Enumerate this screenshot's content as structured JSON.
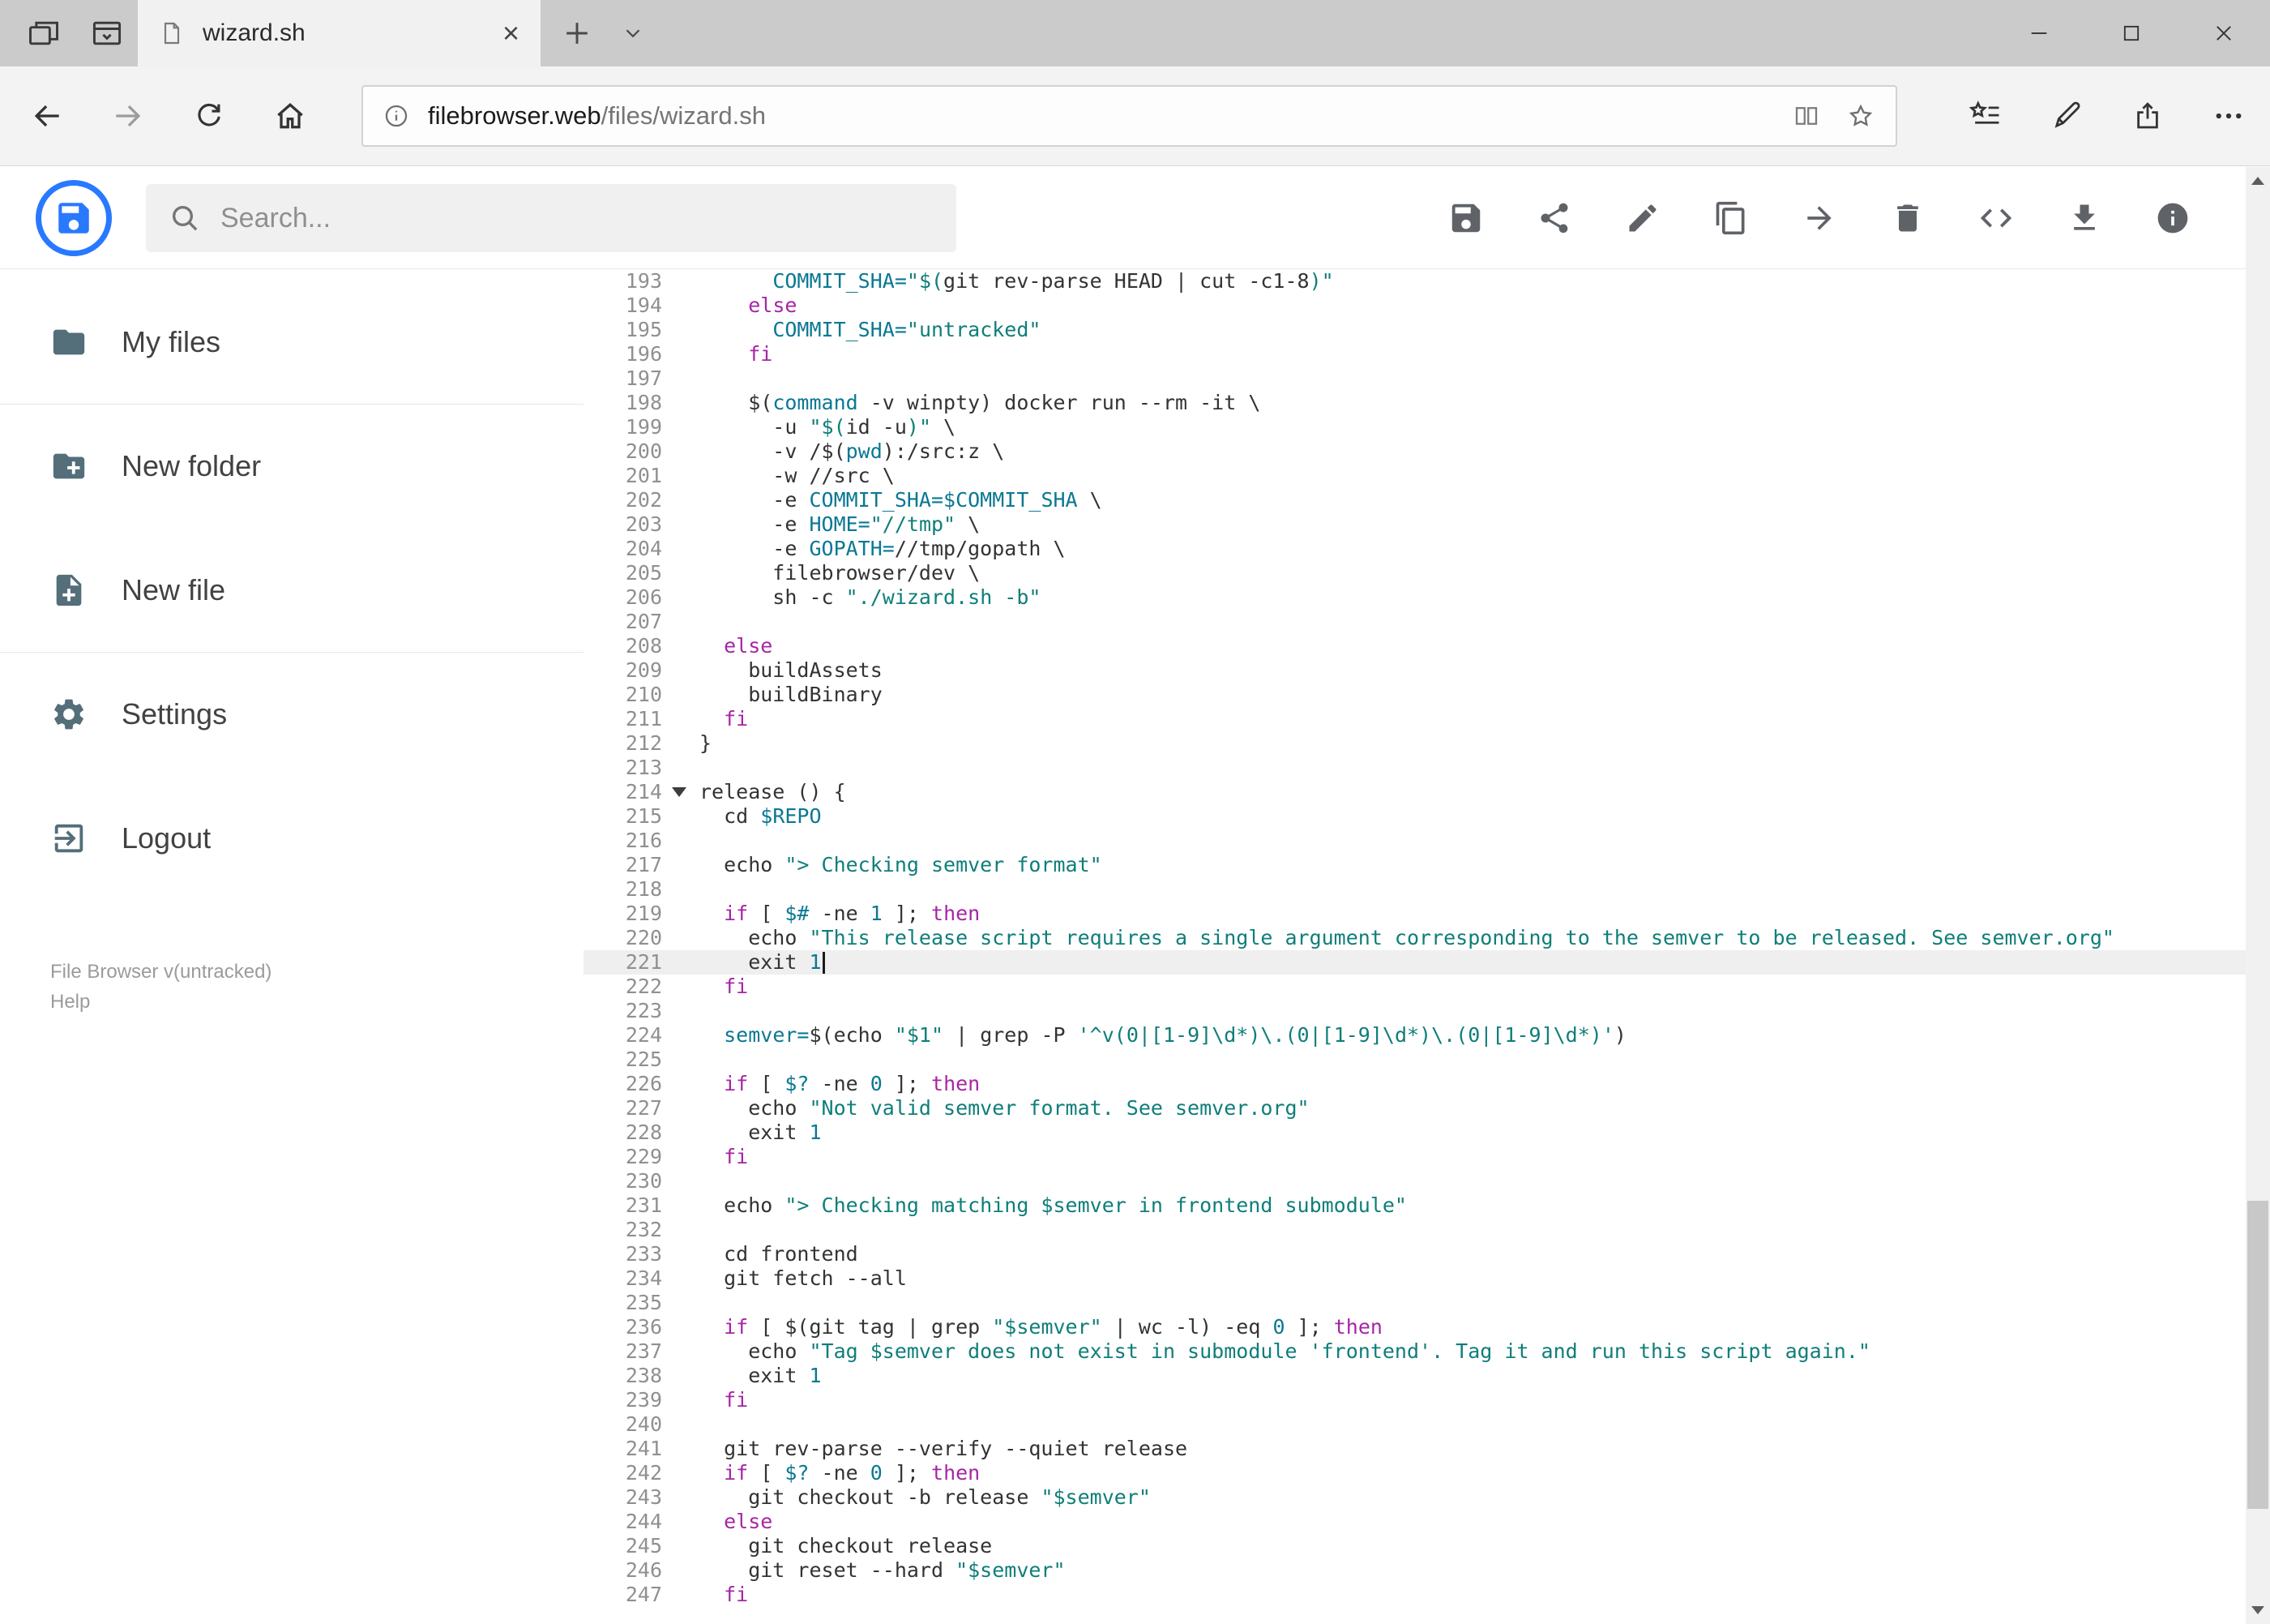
{
  "colors": {
    "accent_blue": "#2979ff",
    "keyword": "#a626a4",
    "string": "#0f7e79",
    "variable": "#0b7893",
    "code_text": "#333333",
    "line_number_gray": "#909090",
    "active_line_bg": "#efefef"
  },
  "browser": {
    "tab_title": "wizard.sh",
    "url_domain": "filebrowser.web",
    "url_path": "/files/wizard.sh"
  },
  "header": {
    "search_placeholder": "Search..."
  },
  "sidebar": {
    "items": [
      {
        "label": "My files",
        "icon": "folder-icon"
      },
      {
        "label": "New folder",
        "icon": "new-folder-icon"
      },
      {
        "label": "New file",
        "icon": "new-file-icon"
      },
      {
        "label": "Settings",
        "icon": "settings-gear-icon"
      },
      {
        "label": "Logout",
        "icon": "logout-icon"
      }
    ],
    "footer_version": "File Browser v(untracked)",
    "footer_help": "Help"
  },
  "editor": {
    "active_line": 221,
    "lines": [
      {
        "n": 193,
        "t": [
          [
            "d",
            "      "
          ],
          [
            "v",
            "COMMIT_SHA="
          ],
          [
            "s",
            "\"$("
          ],
          [
            "d",
            "git rev-parse HEAD | cut -c1-8"
          ],
          [
            "s",
            ")\""
          ]
        ]
      },
      {
        "n": 194,
        "t": [
          [
            "d",
            "    "
          ],
          [
            "k",
            "else"
          ]
        ]
      },
      {
        "n": 195,
        "t": [
          [
            "d",
            "      "
          ],
          [
            "v",
            "COMMIT_SHA="
          ],
          [
            "s",
            "\"untracked\""
          ]
        ]
      },
      {
        "n": 196,
        "t": [
          [
            "d",
            "    "
          ],
          [
            "k",
            "fi"
          ]
        ]
      },
      {
        "n": 197,
        "t": []
      },
      {
        "n": 198,
        "t": [
          [
            "d",
            "    $("
          ],
          [
            "v",
            "command"
          ],
          [
            "d",
            " -v winpty) docker run --rm -it \\"
          ]
        ]
      },
      {
        "n": 199,
        "t": [
          [
            "d",
            "      -u "
          ],
          [
            "s",
            "\"$("
          ],
          [
            "d",
            "id -u"
          ],
          [
            "s",
            ")\""
          ],
          [
            "d",
            " \\"
          ]
        ]
      },
      {
        "n": 200,
        "t": [
          [
            "d",
            "      -v /$("
          ],
          [
            "v",
            "pwd"
          ],
          [
            "d",
            "):/src:z \\"
          ]
        ]
      },
      {
        "n": 201,
        "t": [
          [
            "d",
            "      -w //src \\"
          ]
        ]
      },
      {
        "n": 202,
        "t": [
          [
            "d",
            "      -e "
          ],
          [
            "v",
            "COMMIT_SHA=$COMMIT_SHA"
          ],
          [
            "d",
            " \\"
          ]
        ]
      },
      {
        "n": 203,
        "t": [
          [
            "d",
            "      -e "
          ],
          [
            "v",
            "HOME="
          ],
          [
            "s",
            "\"//tmp\""
          ],
          [
            "d",
            " \\"
          ]
        ]
      },
      {
        "n": 204,
        "t": [
          [
            "d",
            "      -e "
          ],
          [
            "v",
            "GOPATH="
          ],
          [
            "d",
            "//tmp/gopath \\"
          ]
        ]
      },
      {
        "n": 205,
        "t": [
          [
            "d",
            "      filebrowser/dev \\"
          ]
        ]
      },
      {
        "n": 206,
        "t": [
          [
            "d",
            "      sh -c "
          ],
          [
            "s",
            "\"./wizard.sh -b\""
          ]
        ]
      },
      {
        "n": 207,
        "t": []
      },
      {
        "n": 208,
        "t": [
          [
            "d",
            "  "
          ],
          [
            "k",
            "else"
          ]
        ]
      },
      {
        "n": 209,
        "t": [
          [
            "d",
            "    buildAssets"
          ]
        ]
      },
      {
        "n": 210,
        "t": [
          [
            "d",
            "    buildBinary"
          ]
        ]
      },
      {
        "n": 211,
        "t": [
          [
            "d",
            "  "
          ],
          [
            "k",
            "fi"
          ]
        ]
      },
      {
        "n": 212,
        "t": [
          [
            "d",
            "}"
          ]
        ]
      },
      {
        "n": 213,
        "t": []
      },
      {
        "n": 214,
        "f": true,
        "t": [
          [
            "d",
            "release () {"
          ]
        ]
      },
      {
        "n": 215,
        "t": [
          [
            "d",
            "  cd "
          ],
          [
            "v",
            "$REPO"
          ]
        ]
      },
      {
        "n": 216,
        "t": []
      },
      {
        "n": 217,
        "t": [
          [
            "d",
            "  echo "
          ],
          [
            "s",
            "\"> Checking semver format\""
          ]
        ]
      },
      {
        "n": 218,
        "t": []
      },
      {
        "n": 219,
        "t": [
          [
            "d",
            "  "
          ],
          [
            "k",
            "if"
          ],
          [
            "d",
            " [ "
          ],
          [
            "v",
            "$#"
          ],
          [
            "d",
            " -ne "
          ],
          [
            "n",
            "1"
          ],
          [
            "d",
            " ]; "
          ],
          [
            "k",
            "then"
          ]
        ]
      },
      {
        "n": 220,
        "t": [
          [
            "d",
            "    echo "
          ],
          [
            "s",
            "\"This release script requires a single argument corresponding to the semver to be released. See semver.org\""
          ]
        ]
      },
      {
        "n": 221,
        "h": true,
        "c": true,
        "t": [
          [
            "d",
            "    exit "
          ],
          [
            "n",
            "1"
          ]
        ]
      },
      {
        "n": 222,
        "t": [
          [
            "d",
            "  "
          ],
          [
            "k",
            "fi"
          ]
        ]
      },
      {
        "n": 223,
        "t": []
      },
      {
        "n": 224,
        "t": [
          [
            "d",
            "  "
          ],
          [
            "v",
            "semver="
          ],
          [
            "d",
            "$(echo "
          ],
          [
            "s",
            "\"$1\""
          ],
          [
            "d",
            " | grep -P "
          ],
          [
            "s",
            "'^v(0|[1-9]\\d*)\\.(0|[1-9]\\d*)\\.(0|[1-9]\\d*)'"
          ],
          [
            "d",
            ")"
          ]
        ]
      },
      {
        "n": 225,
        "t": []
      },
      {
        "n": 226,
        "t": [
          [
            "d",
            "  "
          ],
          [
            "k",
            "if"
          ],
          [
            "d",
            " [ "
          ],
          [
            "v",
            "$?"
          ],
          [
            "d",
            " -ne "
          ],
          [
            "n",
            "0"
          ],
          [
            "d",
            " ]; "
          ],
          [
            "k",
            "then"
          ]
        ]
      },
      {
        "n": 227,
        "t": [
          [
            "d",
            "    echo "
          ],
          [
            "s",
            "\"Not valid semver format. See semver.org\""
          ]
        ]
      },
      {
        "n": 228,
        "t": [
          [
            "d",
            "    exit "
          ],
          [
            "n",
            "1"
          ]
        ]
      },
      {
        "n": 229,
        "t": [
          [
            "d",
            "  "
          ],
          [
            "k",
            "fi"
          ]
        ]
      },
      {
        "n": 230,
        "t": []
      },
      {
        "n": 231,
        "t": [
          [
            "d",
            "  echo "
          ],
          [
            "s",
            "\"> Checking matching $semver in frontend submodule\""
          ]
        ]
      },
      {
        "n": 232,
        "t": []
      },
      {
        "n": 233,
        "t": [
          [
            "d",
            "  cd frontend"
          ]
        ]
      },
      {
        "n": 234,
        "t": [
          [
            "d",
            "  git fetch --all"
          ]
        ]
      },
      {
        "n": 235,
        "t": []
      },
      {
        "n": 236,
        "t": [
          [
            "d",
            "  "
          ],
          [
            "k",
            "if"
          ],
          [
            "d",
            " [ $(git tag | grep "
          ],
          [
            "s",
            "\"$semver\""
          ],
          [
            "d",
            " | wc -l) -eq "
          ],
          [
            "n",
            "0"
          ],
          [
            "d",
            " ]; "
          ],
          [
            "k",
            "then"
          ]
        ]
      },
      {
        "n": 237,
        "t": [
          [
            "d",
            "    echo "
          ],
          [
            "s",
            "\"Tag $semver does not exist in submodule 'frontend'. Tag it and run this script again.\""
          ]
        ]
      },
      {
        "n": 238,
        "t": [
          [
            "d",
            "    exit "
          ],
          [
            "n",
            "1"
          ]
        ]
      },
      {
        "n": 239,
        "t": [
          [
            "d",
            "  "
          ],
          [
            "k",
            "fi"
          ]
        ]
      },
      {
        "n": 240,
        "t": []
      },
      {
        "n": 241,
        "t": [
          [
            "d",
            "  git rev-parse --verify --quiet release"
          ]
        ]
      },
      {
        "n": 242,
        "t": [
          [
            "d",
            "  "
          ],
          [
            "k",
            "if"
          ],
          [
            "d",
            " [ "
          ],
          [
            "v",
            "$?"
          ],
          [
            "d",
            " -ne "
          ],
          [
            "n",
            "0"
          ],
          [
            "d",
            " ]; "
          ],
          [
            "k",
            "then"
          ]
        ]
      },
      {
        "n": 243,
        "t": [
          [
            "d",
            "    git checkout -b release "
          ],
          [
            "s",
            "\"$semver\""
          ]
        ]
      },
      {
        "n": 244,
        "t": [
          [
            "d",
            "  "
          ],
          [
            "k",
            "else"
          ]
        ]
      },
      {
        "n": 245,
        "t": [
          [
            "d",
            "    git checkout release"
          ]
        ]
      },
      {
        "n": 246,
        "t": [
          [
            "d",
            "    git reset --hard "
          ],
          [
            "s",
            "\"$semver\""
          ]
        ]
      },
      {
        "n": 247,
        "t": [
          [
            "d",
            "  "
          ],
          [
            "k",
            "fi"
          ]
        ]
      }
    ]
  }
}
